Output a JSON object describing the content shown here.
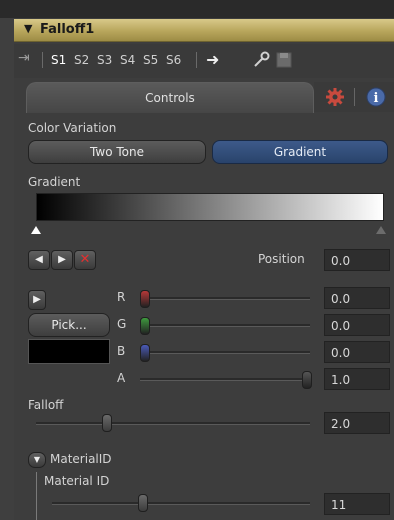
{
  "panel": {
    "title": "Falloff1",
    "slots": [
      "S1",
      "S2",
      "S3",
      "S4",
      "S5",
      "S6"
    ],
    "tabs": {
      "controls": "Controls"
    }
  },
  "color_variation": {
    "label": "Color Variation",
    "options": [
      "Two Tone",
      "Gradient"
    ],
    "selected": "Gradient"
  },
  "gradient": {
    "label": "Gradient",
    "position_label": "Position",
    "position_value": "0.0"
  },
  "color": {
    "pick_label": "Pick...",
    "channels": [
      {
        "name": "R",
        "value": "0.0",
        "knob_color": "#b83838",
        "level": 0.0
      },
      {
        "name": "G",
        "value": "0.0",
        "knob_color": "#3e9a3e",
        "level": 0.0
      },
      {
        "name": "B",
        "value": "0.0",
        "knob_color": "#4a5ab8",
        "level": 0.0
      },
      {
        "name": "A",
        "value": "1.0",
        "knob_color": "#555555",
        "level": 1.0
      }
    ]
  },
  "falloff": {
    "label": "Falloff",
    "value": "2.0"
  },
  "material": {
    "section_label": "MaterialID",
    "label": "Material ID",
    "value": "11"
  },
  "icons": {
    "title_toggle": "triangle-down-icon",
    "pin": "pin-icon",
    "arrow": "arrow-right-icon",
    "key": "key-icon",
    "save": "floppy-icon",
    "settings": "gear-icon",
    "info": "info-icon"
  }
}
